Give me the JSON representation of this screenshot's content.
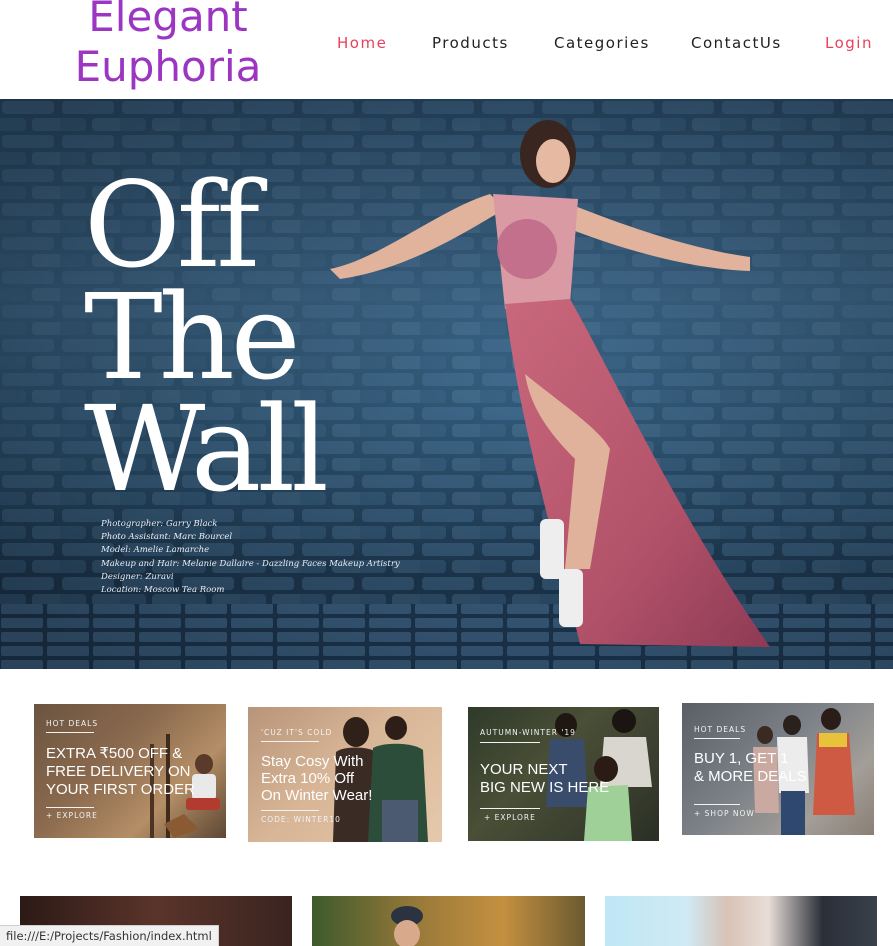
{
  "header": {
    "brand_line1": "Elegant",
    "brand_line2": "Euphoria",
    "nav": {
      "home": "Home",
      "products": "Products",
      "categories": "Categories",
      "contact": "ContactUs",
      "login": "Login"
    }
  },
  "hero": {
    "title_line1": "Off",
    "title_line2": "The",
    "title_line3": "Wall",
    "credits": [
      "Photographer: Garry Black",
      "Photo Assistant: Marc Bourcel",
      "Model: Amelie Lamarche",
      "Makeup and Hair: Melanie Dallaire - Dazzling Faces Makeup Artistry",
      "Designer: Zuravi",
      "Location: Moscow Tea Room"
    ]
  },
  "promos": [
    {
      "tag": "HOT DEALS",
      "headline": [
        "EXTRA ₹500 OFF &",
        "FREE DELIVERY ON",
        "YOUR FIRST ORDER"
      ],
      "cta": "+ EXPLORE"
    },
    {
      "tag": "'CUZ IT'S COLD",
      "headline": [
        "Stay Cosy With",
        "Extra 10% Off",
        "On Winter Wear!"
      ],
      "cta": "CODE: WINTER10"
    },
    {
      "tag": "AUTUMN-WINTER '19",
      "headline": [
        "YOUR NEXT",
        "BIG NEW IS HERE"
      ],
      "cta": "+ EXPLORE"
    },
    {
      "tag": "HOT DEALS",
      "headline": [
        "BUY 1, GET 1",
        "& MORE DEALS"
      ],
      "cta": "+ SHOP NOW"
    }
  ],
  "status_bar": {
    "url": "file:///E:/Projects/Fashion/index.html"
  },
  "colors": {
    "brand": "#9b35c2",
    "nav_active": "#e8415a"
  }
}
